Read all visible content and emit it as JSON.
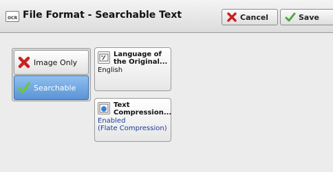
{
  "header": {
    "icon_text": "OCR",
    "title": "File Format - Searchable Text",
    "cancel_label": "Cancel",
    "save_label": "Save"
  },
  "options": [
    {
      "label": "Image Only",
      "icon": "red-x-icon",
      "selected": false
    },
    {
      "label": "Searchable",
      "icon": "green-check-icon",
      "selected": true
    }
  ],
  "language": {
    "label_line1": "Language of",
    "label_line2": "the Original...",
    "value": "English",
    "icon": "language-icon"
  },
  "compression": {
    "label_line1": "Text",
    "label_line2": "Compression...",
    "value_line1": "Enabled",
    "value_line2": "(Flate Compression)",
    "icon": "compression-icon"
  },
  "colors": {
    "selected": "#5a93d6",
    "value_blue": "#1a3e9a",
    "cancel_red": "#cc2020",
    "save_green": "#4aa83a"
  }
}
